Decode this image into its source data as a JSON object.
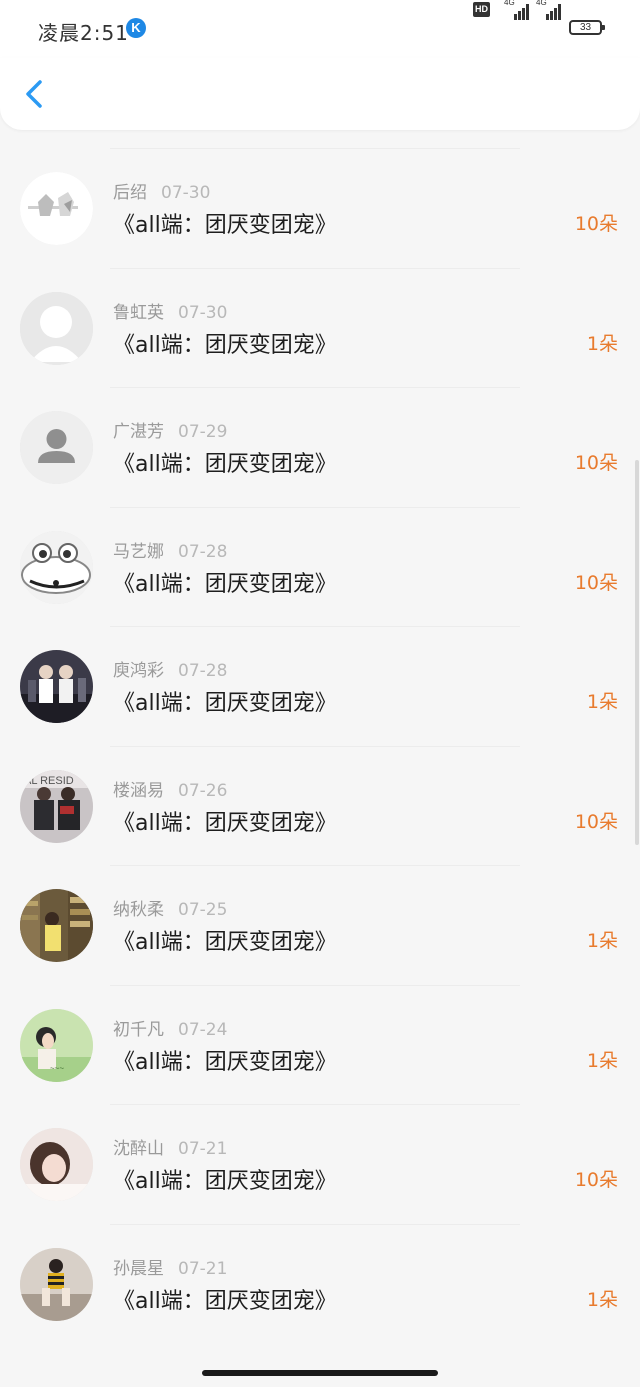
{
  "status_bar": {
    "time": "凌晨2:51",
    "app_badge": "K",
    "hd": "HD",
    "signal1_label": "4G",
    "signal2_label": "4G",
    "battery": "33"
  },
  "header": {
    "back_icon": "chevron-left-icon"
  },
  "list": {
    "items": [
      {
        "name": "后绍",
        "date": "07-30",
        "title": "《all端：团厌变团宠》",
        "count": "10朵",
        "avatar": "sketch-art"
      },
      {
        "name": "鲁虹英",
        "date": "07-30",
        "title": "《all端：团厌变团宠》",
        "count": "1朵",
        "avatar": "blank-silhouette"
      },
      {
        "name": "广湛芳",
        "date": "07-29",
        "title": "《all端：团厌变团宠》",
        "count": "10朵",
        "avatar": "default-user"
      },
      {
        "name": "马艺娜",
        "date": "07-28",
        "title": "《all端：团厌变团宠》",
        "count": "10朵",
        "avatar": "cartoon-creature"
      },
      {
        "name": "庾鸿彩",
        "date": "07-28",
        "title": "《all端：团厌变团宠》",
        "count": "1朵",
        "avatar": "group-photo"
      },
      {
        "name": "楼涵易",
        "date": "07-26",
        "title": "《all端：团厌变团宠》",
        "count": "10朵",
        "avatar": "couple-photo"
      },
      {
        "name": "纳秋柔",
        "date": "07-25",
        "title": "《all端：团厌变团宠》",
        "count": "1朵",
        "avatar": "library-photo"
      },
      {
        "name": "初千凡",
        "date": "07-24",
        "title": "《all端：团厌变团宠》",
        "count": "1朵",
        "avatar": "girl-nature-photo"
      },
      {
        "name": "沈醉山",
        "date": "07-21",
        "title": "《all端：团厌变团宠》",
        "count": "10朵",
        "avatar": "girl-portrait"
      },
      {
        "name": "孙晨星",
        "date": "07-21",
        "title": "《all端：团厌变团宠》",
        "count": "1朵",
        "avatar": "girl-sitting-photo"
      }
    ]
  },
  "colors": {
    "accent_blue": "#2b9af3",
    "count_orange": "#e87b2e",
    "name_gray": "#9a9a9a"
  }
}
